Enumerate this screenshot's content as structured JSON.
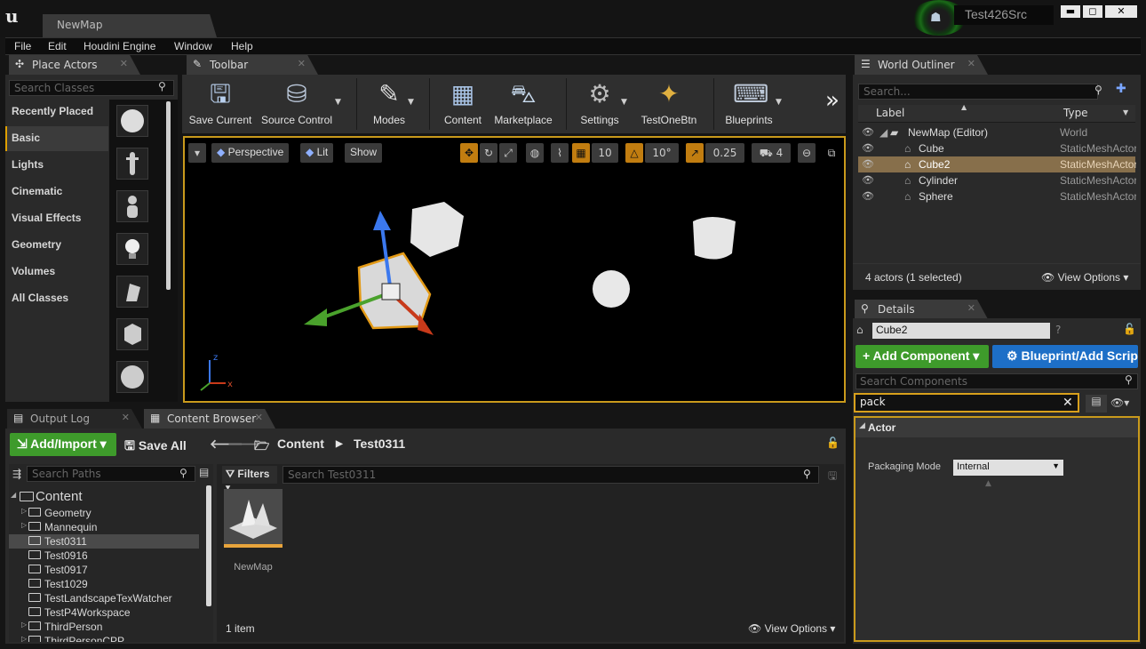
{
  "window": {
    "map_tab": "NewMap",
    "project": "Test426Src",
    "min": "▬",
    "max": "◻",
    "close": "✕"
  },
  "menu": [
    "File",
    "Edit",
    "Houdini Engine",
    "Window",
    "Help"
  ],
  "tabs": {
    "place_actors": "Place Actors",
    "toolbar": "Toolbar",
    "world_outliner": "World Outliner",
    "details": "Details",
    "output_log": "Output Log",
    "content_browser": "Content Browser"
  },
  "place_actors": {
    "search_placeholder": "Search Classes",
    "categories": [
      "Recently Placed",
      "Basic",
      "Lights",
      "Cinematic",
      "Visual Effects",
      "Geometry",
      "Volumes",
      "All Classes"
    ],
    "selected": "Basic"
  },
  "toolbar": {
    "buttons": [
      "Save Current",
      "Source Control",
      "Modes",
      "Content",
      "Marketplace",
      "Settings",
      "TestOneBtn",
      "Blueprints"
    ],
    "more": "»"
  },
  "viewport": {
    "perspective": "Perspective",
    "lit": "Lit",
    "show": "Show",
    "grid_snap": "10",
    "rot_snap": "10°",
    "scale_snap": "0.25",
    "cam_speed": "4",
    "axis_x": "x",
    "axis_z": "z"
  },
  "outliner": {
    "search_placeholder": "Search...",
    "col_label": "Label",
    "col_type": "Type",
    "rows": [
      {
        "label": "NewMap (Editor)",
        "type": "World"
      },
      {
        "label": "Cube",
        "type": "StaticMeshActor"
      },
      {
        "label": "Cube2",
        "type": "StaticMeshActor"
      },
      {
        "label": "Cylinder",
        "type": "StaticMeshActor"
      },
      {
        "label": "Sphere",
        "type": "StaticMeshActor"
      }
    ],
    "summary": "4 actors (1 selected)",
    "view_options": "View Options"
  },
  "details": {
    "name": "Cube2",
    "add_component": "+ Add Component",
    "blueprint": "Blueprint/Add Script",
    "search_placeholder": "Search Components",
    "filter": "pack",
    "section": "Actor",
    "prop_label": "Packaging Mode",
    "prop_value": "Internal"
  },
  "content_browser": {
    "add_import": "Add/Import",
    "save_all": "Save All",
    "breadcrumb": [
      "Content",
      "Test0311"
    ],
    "search_paths": "Search Paths",
    "filters": "Filters",
    "search_placeholder": "Search Test0311",
    "tree": [
      "Content",
      "Geometry",
      "Mannequin",
      "Test0311",
      "Test0916",
      "Test0917",
      "Test1029",
      "TestLandscapeTexWatcher",
      "TestP4Workspace",
      "ThirdPerson",
      "ThirdPersonCPP"
    ],
    "asset": "NewMap",
    "count": "1 item",
    "view_options": "View Options"
  }
}
